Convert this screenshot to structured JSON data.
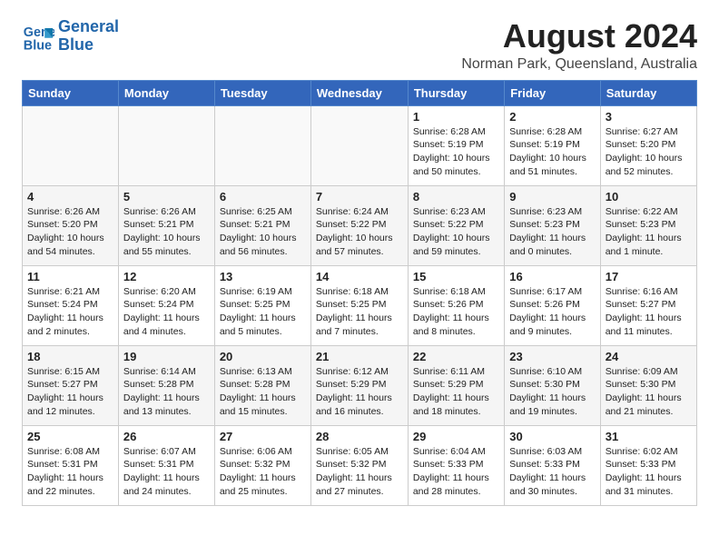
{
  "header": {
    "logo_line1": "General",
    "logo_line2": "Blue",
    "main_title": "August 2024",
    "subtitle": "Norman Park, Queensland, Australia"
  },
  "days_of_week": [
    "Sunday",
    "Monday",
    "Tuesday",
    "Wednesday",
    "Thursday",
    "Friday",
    "Saturday"
  ],
  "weeks": [
    [
      {
        "day": "",
        "info": ""
      },
      {
        "day": "",
        "info": ""
      },
      {
        "day": "",
        "info": ""
      },
      {
        "day": "",
        "info": ""
      },
      {
        "day": "1",
        "info": "Sunrise: 6:28 AM\nSunset: 5:19 PM\nDaylight: 10 hours and 50 minutes."
      },
      {
        "day": "2",
        "info": "Sunrise: 6:28 AM\nSunset: 5:19 PM\nDaylight: 10 hours and 51 minutes."
      },
      {
        "day": "3",
        "info": "Sunrise: 6:27 AM\nSunset: 5:20 PM\nDaylight: 10 hours and 52 minutes."
      }
    ],
    [
      {
        "day": "4",
        "info": "Sunrise: 6:26 AM\nSunset: 5:20 PM\nDaylight: 10 hours and 54 minutes."
      },
      {
        "day": "5",
        "info": "Sunrise: 6:26 AM\nSunset: 5:21 PM\nDaylight: 10 hours and 55 minutes."
      },
      {
        "day": "6",
        "info": "Sunrise: 6:25 AM\nSunset: 5:21 PM\nDaylight: 10 hours and 56 minutes."
      },
      {
        "day": "7",
        "info": "Sunrise: 6:24 AM\nSunset: 5:22 PM\nDaylight: 10 hours and 57 minutes."
      },
      {
        "day": "8",
        "info": "Sunrise: 6:23 AM\nSunset: 5:22 PM\nDaylight: 10 hours and 59 minutes."
      },
      {
        "day": "9",
        "info": "Sunrise: 6:23 AM\nSunset: 5:23 PM\nDaylight: 11 hours and 0 minutes."
      },
      {
        "day": "10",
        "info": "Sunrise: 6:22 AM\nSunset: 5:23 PM\nDaylight: 11 hours and 1 minute."
      }
    ],
    [
      {
        "day": "11",
        "info": "Sunrise: 6:21 AM\nSunset: 5:24 PM\nDaylight: 11 hours and 2 minutes."
      },
      {
        "day": "12",
        "info": "Sunrise: 6:20 AM\nSunset: 5:24 PM\nDaylight: 11 hours and 4 minutes."
      },
      {
        "day": "13",
        "info": "Sunrise: 6:19 AM\nSunset: 5:25 PM\nDaylight: 11 hours and 5 minutes."
      },
      {
        "day": "14",
        "info": "Sunrise: 6:18 AM\nSunset: 5:25 PM\nDaylight: 11 hours and 7 minutes."
      },
      {
        "day": "15",
        "info": "Sunrise: 6:18 AM\nSunset: 5:26 PM\nDaylight: 11 hours and 8 minutes."
      },
      {
        "day": "16",
        "info": "Sunrise: 6:17 AM\nSunset: 5:26 PM\nDaylight: 11 hours and 9 minutes."
      },
      {
        "day": "17",
        "info": "Sunrise: 6:16 AM\nSunset: 5:27 PM\nDaylight: 11 hours and 11 minutes."
      }
    ],
    [
      {
        "day": "18",
        "info": "Sunrise: 6:15 AM\nSunset: 5:27 PM\nDaylight: 11 hours and 12 minutes."
      },
      {
        "day": "19",
        "info": "Sunrise: 6:14 AM\nSunset: 5:28 PM\nDaylight: 11 hours and 13 minutes."
      },
      {
        "day": "20",
        "info": "Sunrise: 6:13 AM\nSunset: 5:28 PM\nDaylight: 11 hours and 15 minutes."
      },
      {
        "day": "21",
        "info": "Sunrise: 6:12 AM\nSunset: 5:29 PM\nDaylight: 11 hours and 16 minutes."
      },
      {
        "day": "22",
        "info": "Sunrise: 6:11 AM\nSunset: 5:29 PM\nDaylight: 11 hours and 18 minutes."
      },
      {
        "day": "23",
        "info": "Sunrise: 6:10 AM\nSunset: 5:30 PM\nDaylight: 11 hours and 19 minutes."
      },
      {
        "day": "24",
        "info": "Sunrise: 6:09 AM\nSunset: 5:30 PM\nDaylight: 11 hours and 21 minutes."
      }
    ],
    [
      {
        "day": "25",
        "info": "Sunrise: 6:08 AM\nSunset: 5:31 PM\nDaylight: 11 hours and 22 minutes."
      },
      {
        "day": "26",
        "info": "Sunrise: 6:07 AM\nSunset: 5:31 PM\nDaylight: 11 hours and 24 minutes."
      },
      {
        "day": "27",
        "info": "Sunrise: 6:06 AM\nSunset: 5:32 PM\nDaylight: 11 hours and 25 minutes."
      },
      {
        "day": "28",
        "info": "Sunrise: 6:05 AM\nSunset: 5:32 PM\nDaylight: 11 hours and 27 minutes."
      },
      {
        "day": "29",
        "info": "Sunrise: 6:04 AM\nSunset: 5:33 PM\nDaylight: 11 hours and 28 minutes."
      },
      {
        "day": "30",
        "info": "Sunrise: 6:03 AM\nSunset: 5:33 PM\nDaylight: 11 hours and 30 minutes."
      },
      {
        "day": "31",
        "info": "Sunrise: 6:02 AM\nSunset: 5:33 PM\nDaylight: 11 hours and 31 minutes."
      }
    ]
  ]
}
